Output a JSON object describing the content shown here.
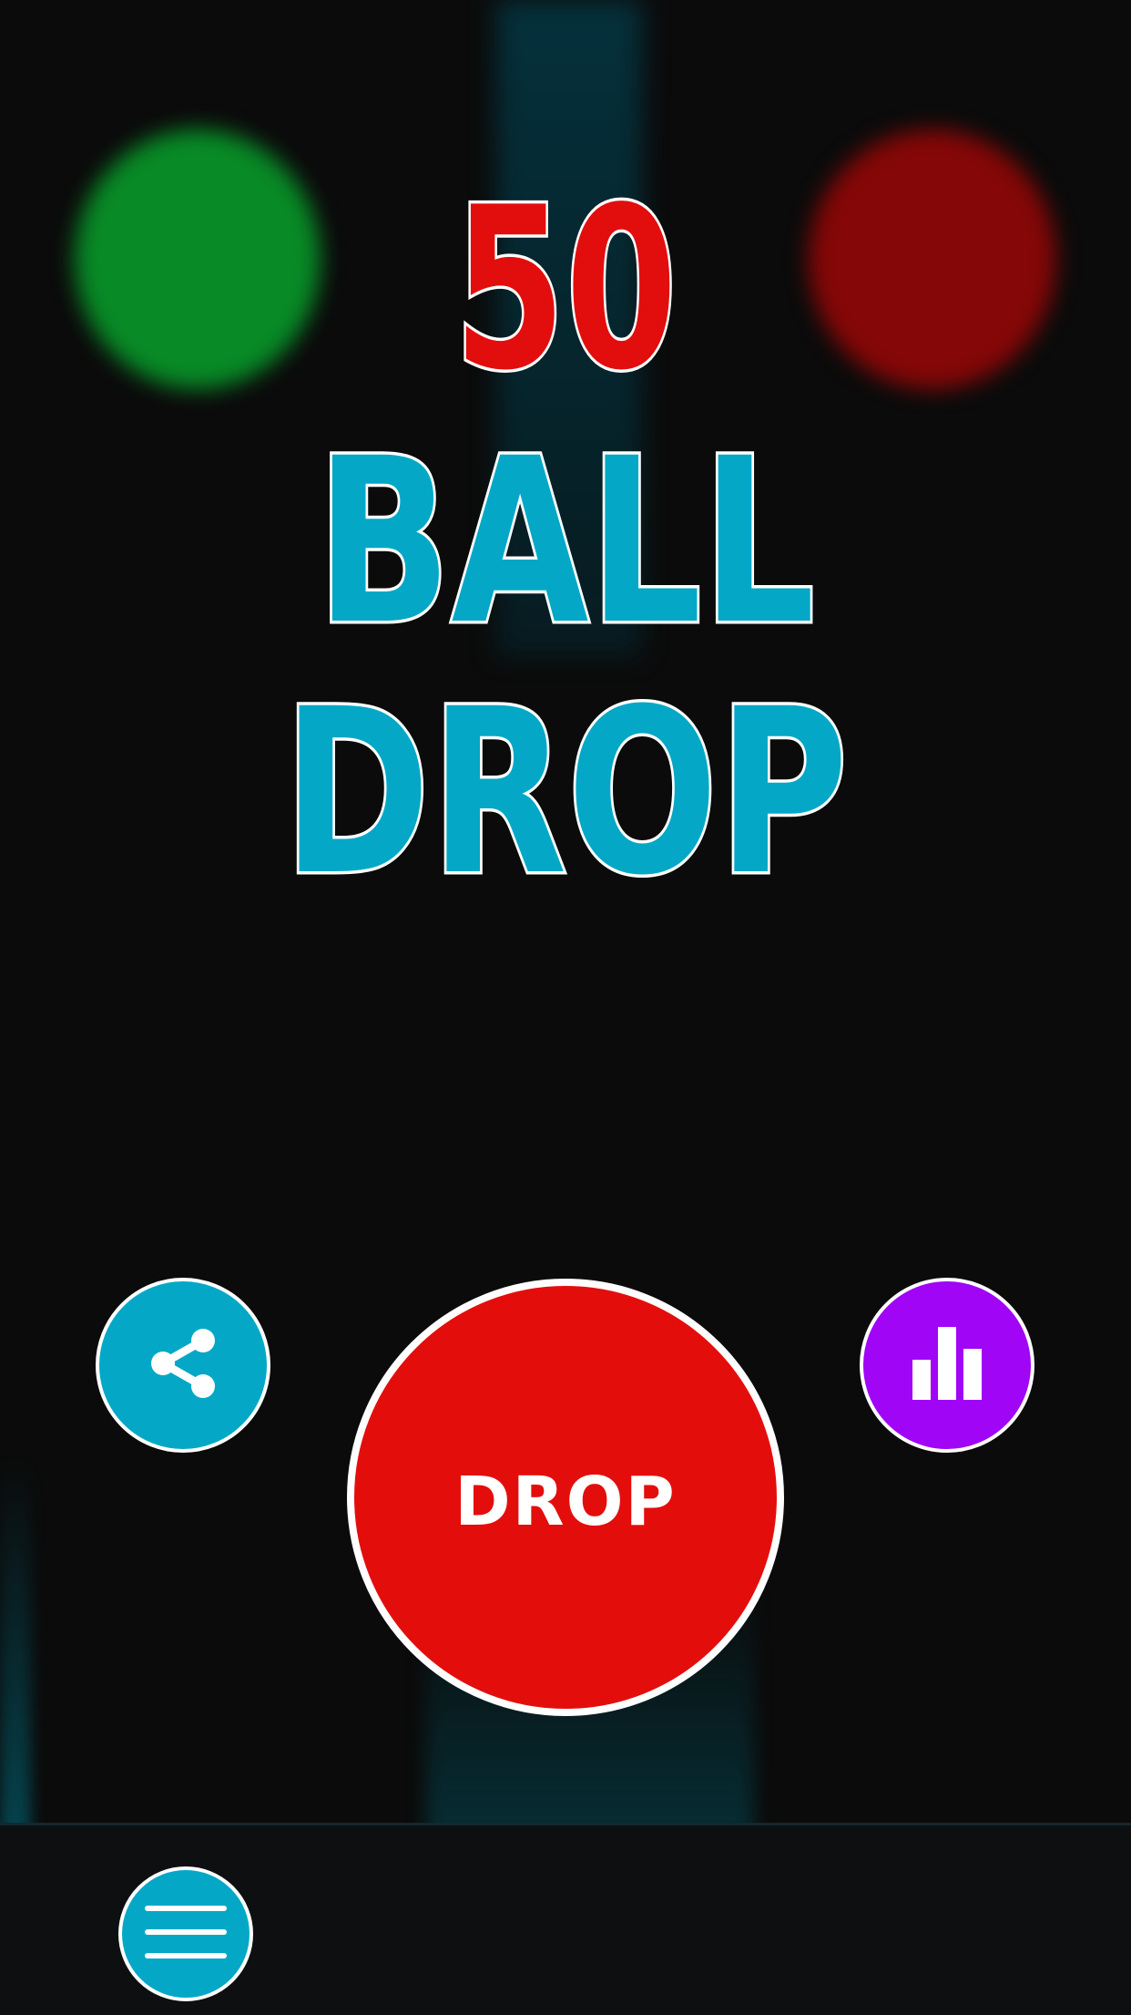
{
  "title": {
    "number": "50",
    "line1": "BALL",
    "line2": "DROP"
  },
  "buttons": {
    "drop_label": "DROP",
    "share_icon": "share-icon",
    "stats_icon": "bar-chart-icon",
    "menu_icon": "hamburger-menu-icon"
  },
  "colors": {
    "background": "#0b0b0b",
    "title_number": "#e20e0d",
    "title_words": "#04a8c6",
    "drop_button": "#e30e0c",
    "share_button": "#04a8c6",
    "stats_button": "#a005f6",
    "menu_button": "#04a8c6",
    "outline": "#ffffff",
    "background_green_ball": "#088a26",
    "background_red_ball": "#850707"
  }
}
